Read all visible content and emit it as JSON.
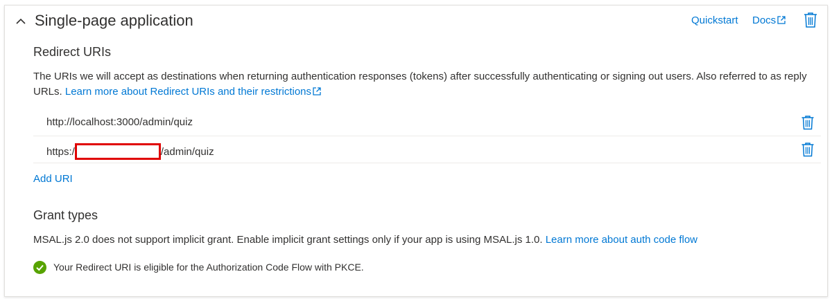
{
  "section": {
    "title": "Single-page application",
    "quickstart_label": "Quickstart",
    "docs_label": "Docs"
  },
  "redirect": {
    "heading": "Redirect URIs",
    "description": "The URIs we will accept as destinations when returning authentication responses (tokens) after successfully authenticating or signing out users. Also referred to as reply URLs.",
    "learn_more": "Learn more about Redirect URIs and their restrictions",
    "uris": [
      {
        "prefix": "http://localhost:3000/admin/quiz",
        "suffix": ""
      },
      {
        "prefix": "https:/",
        "suffix": "/admin/quiz"
      }
    ],
    "add_uri_label": "Add URI"
  },
  "grant": {
    "heading": "Grant types",
    "description": "MSAL.js 2.0 does not support implicit grant. Enable implicit grant settings only if your app is using MSAL.js 1.0.",
    "learn_more": "Learn more about auth code flow",
    "status_text": "Your Redirect URI is eligible for the Authorization Code Flow with PKCE."
  },
  "colors": {
    "link": "#0078d4",
    "success": "#57a300",
    "redaction": "#e00000"
  }
}
